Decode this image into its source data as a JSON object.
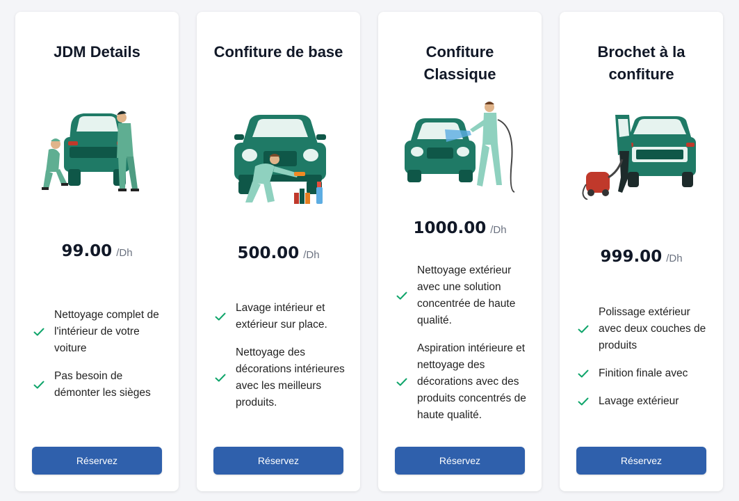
{
  "cards": [
    {
      "title": "JDM Details",
      "price": "99.00",
      "unit": "/Dh",
      "features": [
        "Nettoyage complet de l'intérieur de votre voiture",
        "Pas besoin de démonter les sièges"
      ],
      "button": "Réservez"
    },
    {
      "title": "Confiture de base",
      "price": "500.00",
      "unit": "/Dh",
      "features": [
        "Lavage intérieur et extérieur sur place.",
        "Nettoyage des décorations intérieures avec les meilleurs produits."
      ],
      "button": "Réservez"
    },
    {
      "title": "Confiture Classique",
      "price": "1000.00",
      "unit": "/Dh",
      "features": [
        "Nettoyage extérieur avec une solution concentrée de haute qualité.",
        "Aspiration intérieure et nettoyage des décorations avec des produits concentrés de haute qualité."
      ],
      "button": "Réservez"
    },
    {
      "title": "Brochet à la confiture",
      "price": "999.00",
      "unit": "/Dh",
      "features": [
        "Polissage extérieur avec deux couches de produits",
        "Finition finale avec",
        "Lavage extérieur"
      ],
      "button": "Réservez"
    }
  ],
  "icons": {
    "check": "check-icon"
  },
  "colors": {
    "accent": "#2f60ac",
    "check": "#10a56b",
    "car": "#1f7a66",
    "car_dark": "#0f5748",
    "worker": "#5fae92"
  }
}
